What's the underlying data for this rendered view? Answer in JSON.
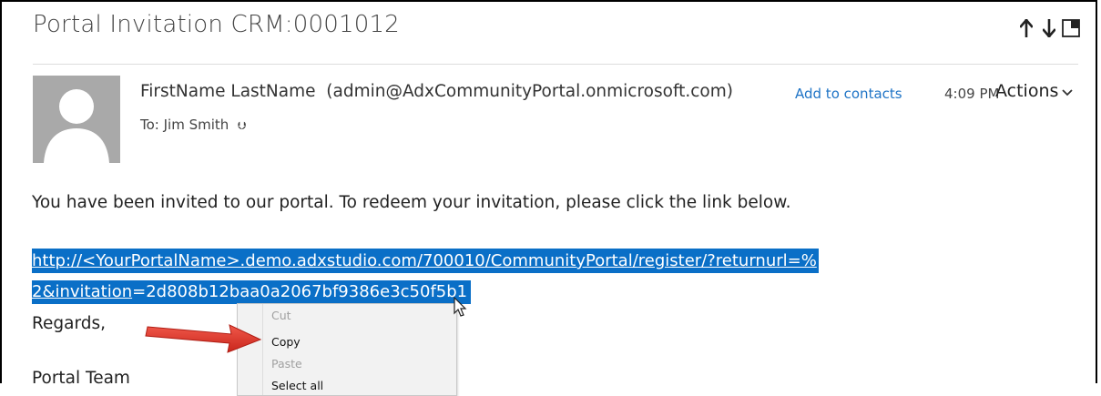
{
  "email": {
    "subject": "Portal Invitation CRM:0001012",
    "sender_name": "FirstName LastName",
    "sender_email": "(admin@AdxCommunityPortal.onmicrosoft.com)",
    "add_to_contacts": "Add to contacts",
    "time": "4:09 PM",
    "actions_label": "Actions",
    "to_line": "To: Jim Smith",
    "body_line": "You have been invited to our portal. To redeem your invitation, please click the link below.",
    "link_line1": "http://<YourPortalName>.demo.adxstudio.com/700010/CommunityPortal/register/?returnurl=%",
    "link_line2_part1": "2&invitation",
    "link_line2_part2": "=2d808b12baa0a2067bf9386e3c50f5b1",
    "regards": "Regards,",
    "signature": "Portal Team"
  },
  "context_menu": {
    "items": [
      {
        "label": "Cut",
        "enabled": false
      },
      {
        "label": "Copy",
        "enabled": true
      },
      {
        "label": "Paste",
        "enabled": false
      },
      {
        "label": "Select all",
        "enabled": true
      }
    ]
  },
  "icons": {
    "up": "arrow-up-icon",
    "down": "arrow-down-icon",
    "popout": "pop-out-icon",
    "avatar": "person-silhouette-icon",
    "pointer": "mouse-pointer-icon",
    "callout": "red-callout-arrow"
  },
  "colors": {
    "link": "#1f74c6",
    "selection": "#0a6fc7",
    "callout": "#e03a2f",
    "avatar_bg": "#a9a9a9"
  }
}
